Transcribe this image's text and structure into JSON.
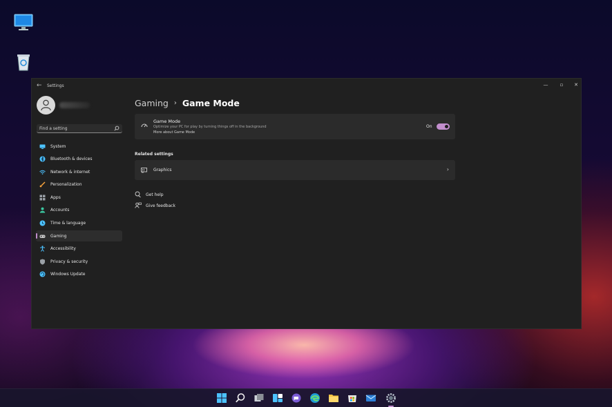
{
  "window": {
    "title": "Settings"
  },
  "search": {
    "placeholder": "Find a setting"
  },
  "sidebar": {
    "items": [
      {
        "label": "System",
        "icon": "monitor-icon",
        "color": "#4cc2ff"
      },
      {
        "label": "Bluetooth & devices",
        "icon": "bluetooth-icon",
        "color": "#4cc2ff"
      },
      {
        "label": "Network & internet",
        "icon": "wifi-icon",
        "color": "#4cc2ff"
      },
      {
        "label": "Personalization",
        "icon": "brush-icon",
        "color": "#f7a23c"
      },
      {
        "label": "Apps",
        "icon": "apps-icon",
        "color": "#9aa0a6"
      },
      {
        "label": "Accounts",
        "icon": "person-icon",
        "color": "#3cc7a0"
      },
      {
        "label": "Time & language",
        "icon": "globe-clock-icon",
        "color": "#4cc2ff"
      },
      {
        "label": "Gaming",
        "icon": "gamepad-icon",
        "color": "#c8c8c8"
      },
      {
        "label": "Accessibility",
        "icon": "accessibility-icon",
        "color": "#4cc2ff"
      },
      {
        "label": "Privacy & security",
        "icon": "shield-icon",
        "color": "#9aa0a6"
      },
      {
        "label": "Windows Update",
        "icon": "update-icon",
        "color": "#4cc2ff"
      }
    ],
    "active_index": 7
  },
  "breadcrumb": {
    "parent": "Gaming",
    "separator": "›",
    "current": "Game Mode"
  },
  "game_mode_card": {
    "title": "Game Mode",
    "description": "Optimize your PC for play by turning things off in the background",
    "link": "More about Game Mode",
    "toggle_label": "On",
    "toggle_on": true
  },
  "related": {
    "heading": "Related settings",
    "graphics_label": "Graphics"
  },
  "help": {
    "get_help": "Get help",
    "give_feedback": "Give feedback"
  },
  "colors": {
    "accent": "#c28ecd"
  }
}
